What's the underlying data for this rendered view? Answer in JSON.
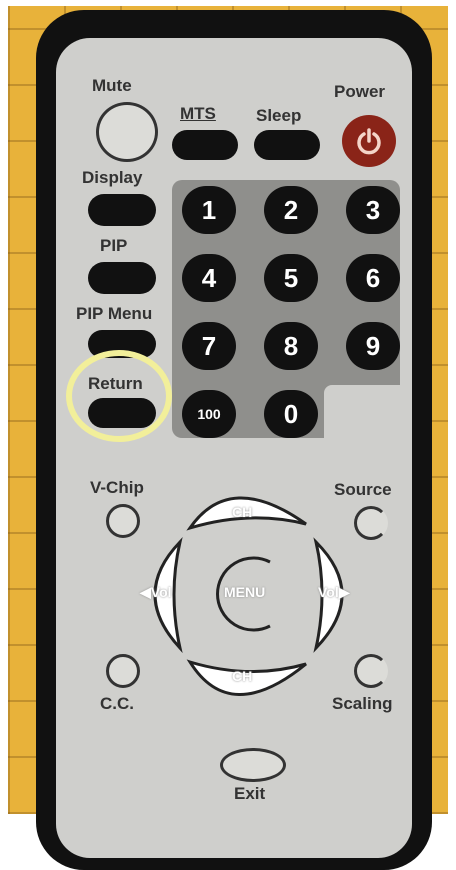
{
  "remote": {
    "buttons": {
      "mute": "Mute",
      "mts": "MTS",
      "sleep": "Sleep",
      "power": "Power",
      "display": "Display",
      "pip": "PIP",
      "pip_menu": "PIP Menu",
      "return": "Return",
      "vchip": "V-Chip",
      "source": "Source",
      "cc": "C.C.",
      "scaling": "Scaling",
      "exit": "Exit"
    },
    "numpad": [
      "1",
      "2",
      "3",
      "4",
      "5",
      "6",
      "7",
      "8",
      "9",
      "100",
      "0"
    ],
    "dpad": {
      "up": "CH",
      "down": "CH",
      "left": "◀Vol",
      "right": "Vol▶",
      "center": "MENU"
    }
  },
  "colors": {
    "background": "#e8b23a",
    "remote_body": "#111111",
    "remote_face": "#cfcfcc",
    "power_button": "#8a2418",
    "highlight_ring": "#f2ef9a"
  }
}
